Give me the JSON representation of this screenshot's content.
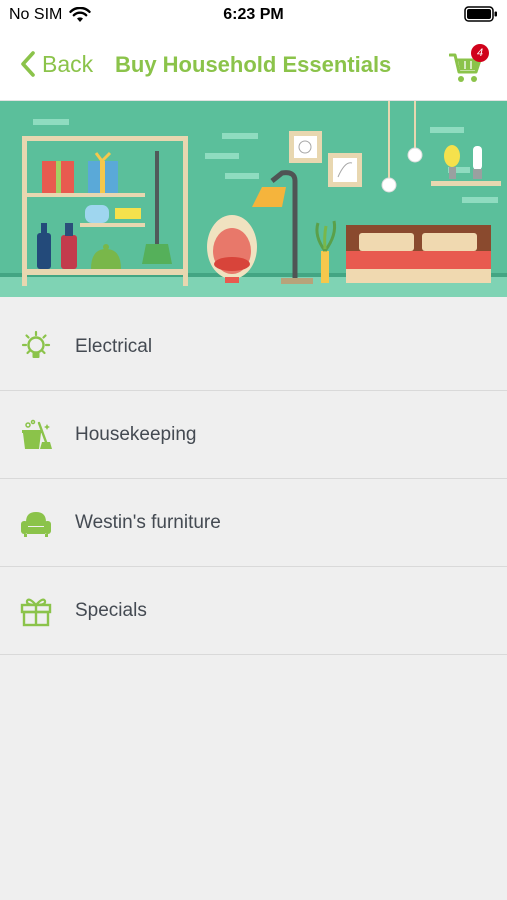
{
  "status": {
    "carrier": "No SIM",
    "time": "6:23 PM"
  },
  "nav": {
    "back_label": "Back",
    "title": "Buy Household Essentials",
    "cart_count": "4"
  },
  "categories": [
    {
      "label": "Electrical",
      "icon": "lightbulb-icon"
    },
    {
      "label": "Housekeeping",
      "icon": "cleaning-bucket-icon"
    },
    {
      "label": "Westin's furniture",
      "icon": "armchair-icon"
    },
    {
      "label": "Specials",
      "icon": "gift-icon"
    }
  ],
  "colors": {
    "accent": "#8bc34a",
    "badge": "#d0021b",
    "banner_bg": "#5bbf9b"
  }
}
